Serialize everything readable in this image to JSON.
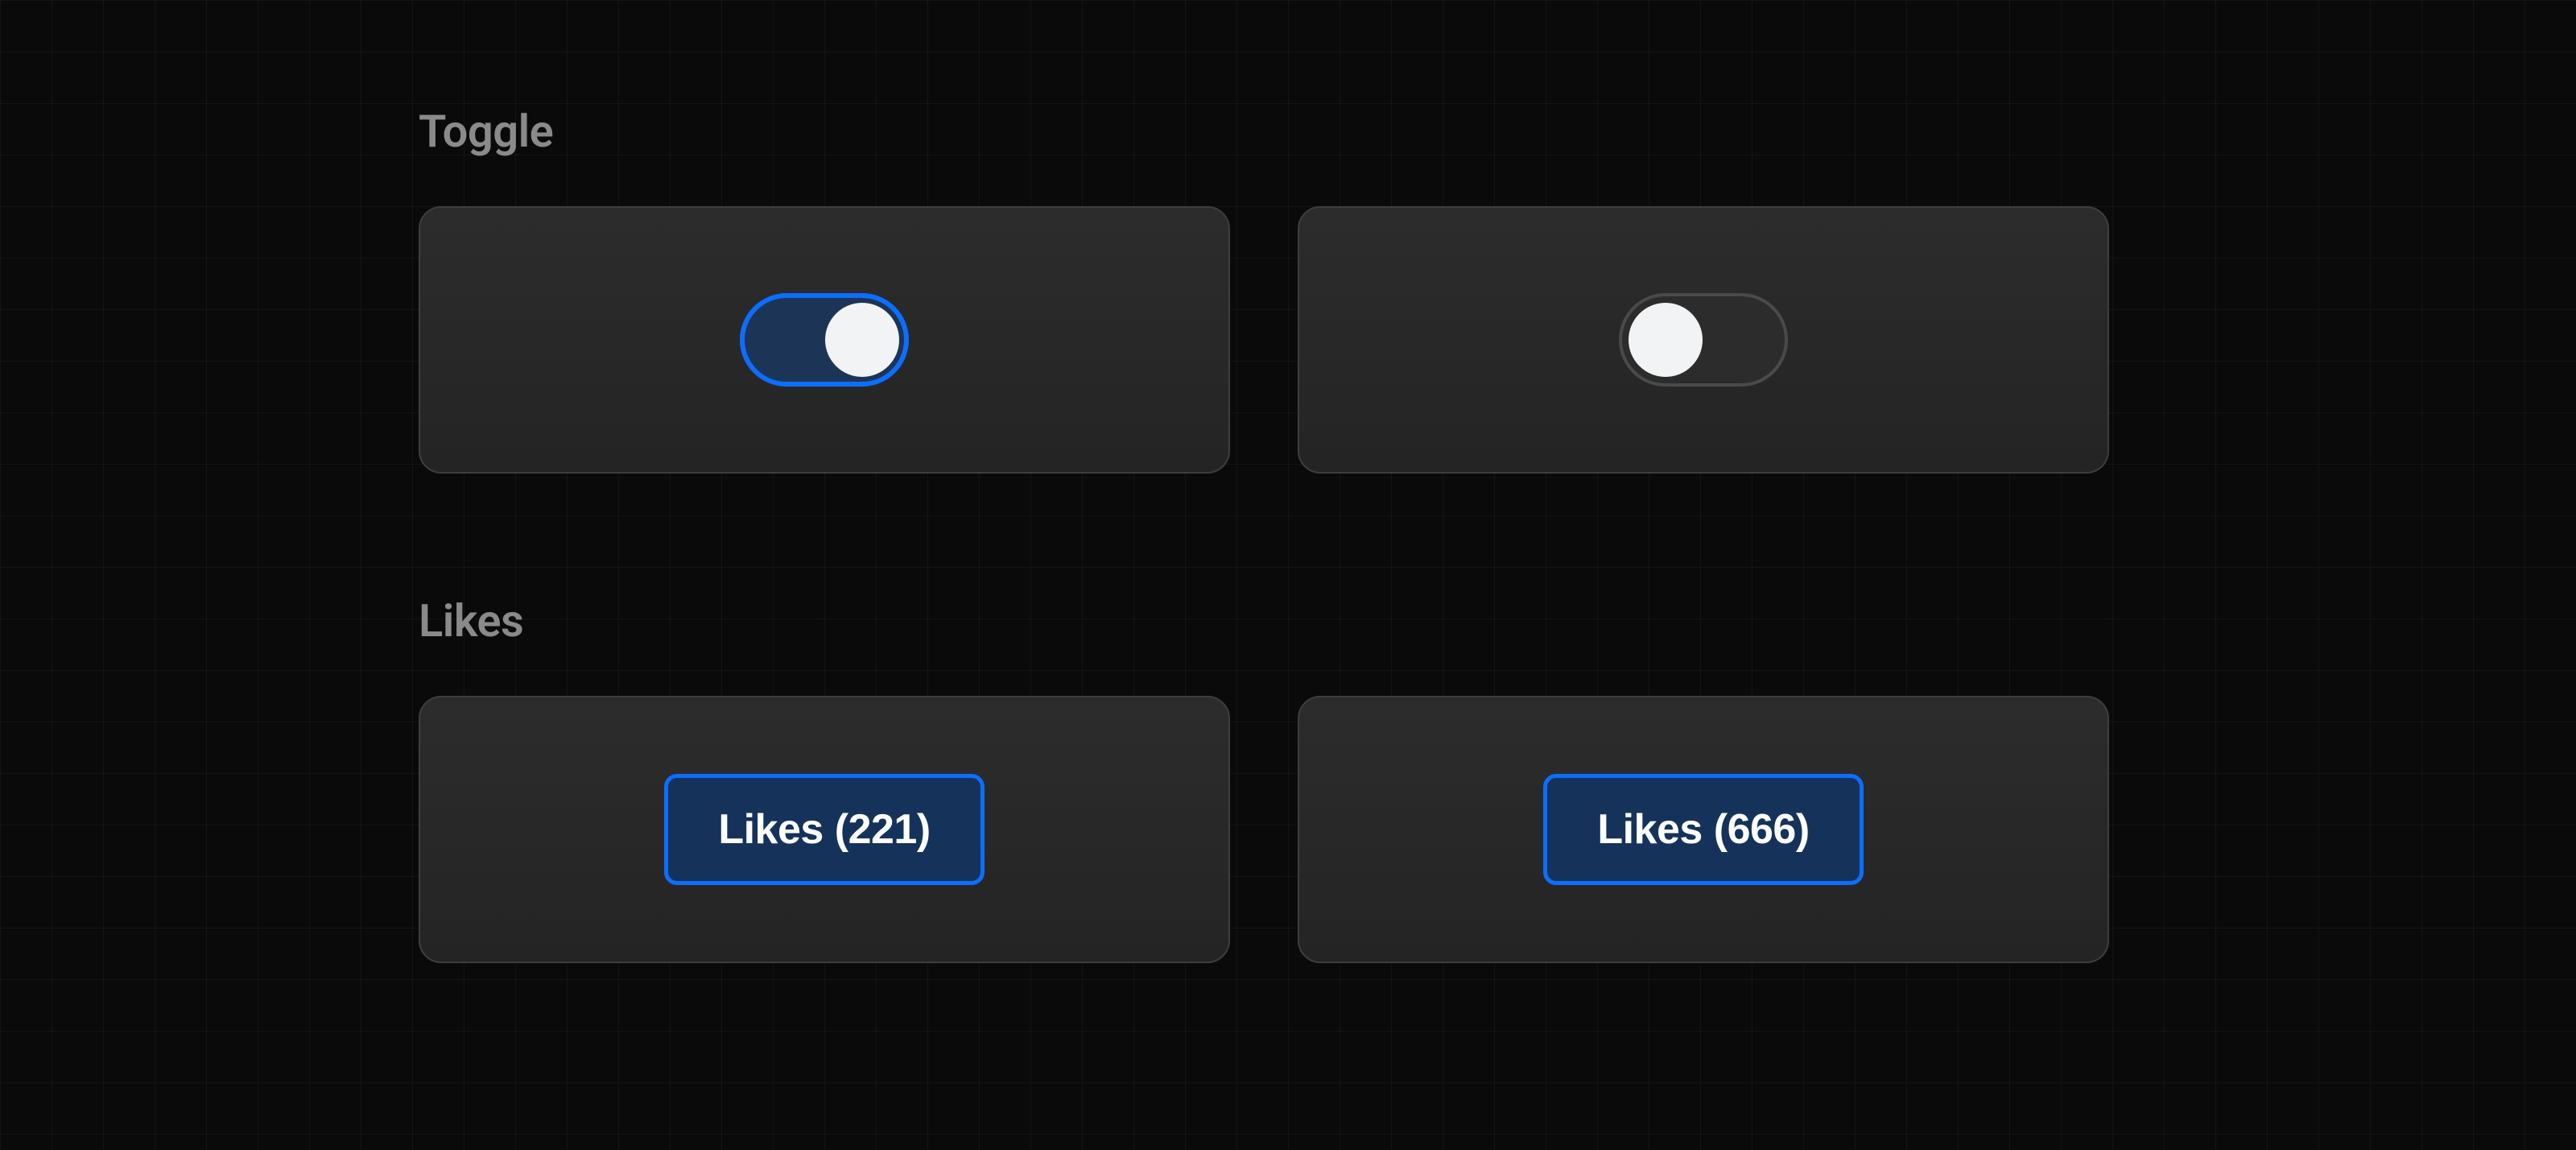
{
  "sections": {
    "toggle": {
      "heading": "Toggle",
      "items": [
        {
          "state": "on"
        },
        {
          "state": "off"
        }
      ]
    },
    "likes": {
      "heading": "Likes",
      "items": [
        {
          "label": "Likes (221)"
        },
        {
          "label": "Likes (666)"
        }
      ]
    }
  },
  "colors": {
    "accent": "#0d6efd",
    "accent_fill": "#15335a",
    "card_bg": "#2a2a2a",
    "card_border": "#3e3e3e",
    "heading": "#8a8a8a",
    "thumb": "#f1f3f5"
  }
}
